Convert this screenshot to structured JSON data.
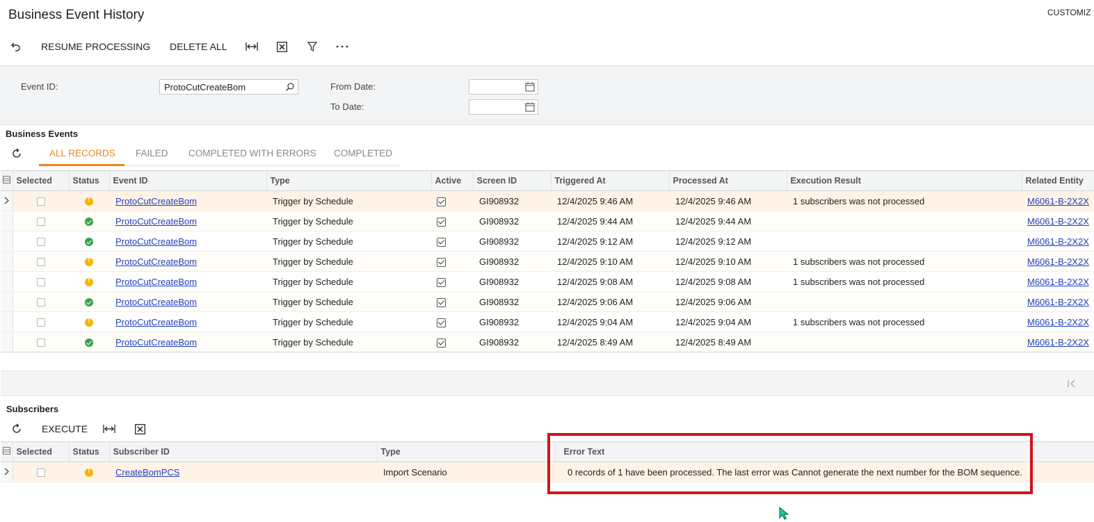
{
  "header": {
    "title": "Business Event History",
    "customize_label": "CUSTOMIZ"
  },
  "toolbar": {
    "undo_icon": "undo-icon",
    "resume_label": "RESUME PROCESSING",
    "delete_all_label": "DELETE ALL",
    "fit_icon": "fit-columns-icon",
    "excel_icon": "excel-export-icon",
    "filter_icon": "filter-icon",
    "more_icon": "more-icon"
  },
  "filters": {
    "event_id_label": "Event ID:",
    "event_id_value": "ProtoCutCreateBom",
    "from_date_label": "From Date:",
    "from_date_value": "",
    "to_date_label": "To Date:",
    "to_date_value": ""
  },
  "business_events": {
    "title": "Business Events",
    "tabs": [
      "ALL RECORDS",
      "FAILED",
      "COMPLETED WITH ERRORS",
      "COMPLETED"
    ],
    "active_tab": "ALL RECORDS",
    "columns": [
      "Selected",
      "Status",
      "Event ID",
      "Type",
      "Active",
      "Screen ID",
      "Triggered At",
      "Processed At",
      "Execution Result",
      "Related Entity"
    ],
    "rows": [
      {
        "status": "warning",
        "event_id": "ProtoCutCreateBom",
        "type": "Trigger by Schedule",
        "active": true,
        "screen_id": "GI908932",
        "triggered_at": "12/4/2025 9:46 AM",
        "processed_at": "12/4/2025 9:46 AM",
        "execution_result": "1 subscribers was not processed",
        "related_entity": "M6061-B-2X2X"
      },
      {
        "status": "success",
        "event_id": "ProtoCutCreateBom",
        "type": "Trigger by Schedule",
        "active": true,
        "screen_id": "GI908932",
        "triggered_at": "12/4/2025 9:44 AM",
        "processed_at": "12/4/2025 9:44 AM",
        "execution_result": "",
        "related_entity": "M6061-B-2X2X"
      },
      {
        "status": "success",
        "event_id": "ProtoCutCreateBom",
        "type": "Trigger by Schedule",
        "active": true,
        "screen_id": "GI908932",
        "triggered_at": "12/4/2025 9:12 AM",
        "processed_at": "12/4/2025 9:12 AM",
        "execution_result": "",
        "related_entity": "M6061-B-2X2X"
      },
      {
        "status": "warning",
        "event_id": "ProtoCutCreateBom",
        "type": "Trigger by Schedule",
        "active": true,
        "screen_id": "GI908932",
        "triggered_at": "12/4/2025 9:10 AM",
        "processed_at": "12/4/2025 9:10 AM",
        "execution_result": "1 subscribers was not processed",
        "related_entity": "M6061-B-2X2X"
      },
      {
        "status": "warning",
        "event_id": "ProtoCutCreateBom",
        "type": "Trigger by Schedule",
        "active": true,
        "screen_id": "GI908932",
        "triggered_at": "12/4/2025 9:08 AM",
        "processed_at": "12/4/2025 9:08 AM",
        "execution_result": "1 subscribers was not processed",
        "related_entity": "M6061-B-2X2X"
      },
      {
        "status": "success",
        "event_id": "ProtoCutCreateBom",
        "type": "Trigger by Schedule",
        "active": true,
        "screen_id": "GI908932",
        "triggered_at": "12/4/2025 9:06 AM",
        "processed_at": "12/4/2025 9:06 AM",
        "execution_result": "",
        "related_entity": "M6061-B-2X2X"
      },
      {
        "status": "warning",
        "event_id": "ProtoCutCreateBom",
        "type": "Trigger by Schedule",
        "active": true,
        "screen_id": "GI908932",
        "triggered_at": "12/4/2025 9:04 AM",
        "processed_at": "12/4/2025 9:04 AM",
        "execution_result": "1 subscribers was not processed",
        "related_entity": "M6061-B-2X2X"
      },
      {
        "status": "success",
        "event_id": "ProtoCutCreateBom",
        "type": "Trigger by Schedule",
        "active": true,
        "screen_id": "GI908932",
        "triggered_at": "12/4/2025 8:49 AM",
        "processed_at": "12/4/2025 8:49 AM",
        "execution_result": "",
        "related_entity": "M6061-B-2X2X"
      }
    ]
  },
  "subscribers": {
    "title": "Subscribers",
    "execute_label": "EXECUTE",
    "columns": [
      "Selected",
      "Status",
      "Subscriber ID",
      "Type",
      "Error Text"
    ],
    "rows": [
      {
        "status": "warning",
        "subscriber_id": "CreateBomPCS",
        "type": "Import Scenario",
        "error_text": "0 records of 1 have been processed. The last error was Cannot generate the next number for the BOM sequence."
      }
    ]
  },
  "colors": {
    "accent": "#e8891e",
    "link": "#1f3fbf",
    "warning": "#f5b400",
    "success": "#37a24a",
    "highlight": "#d0141a"
  }
}
